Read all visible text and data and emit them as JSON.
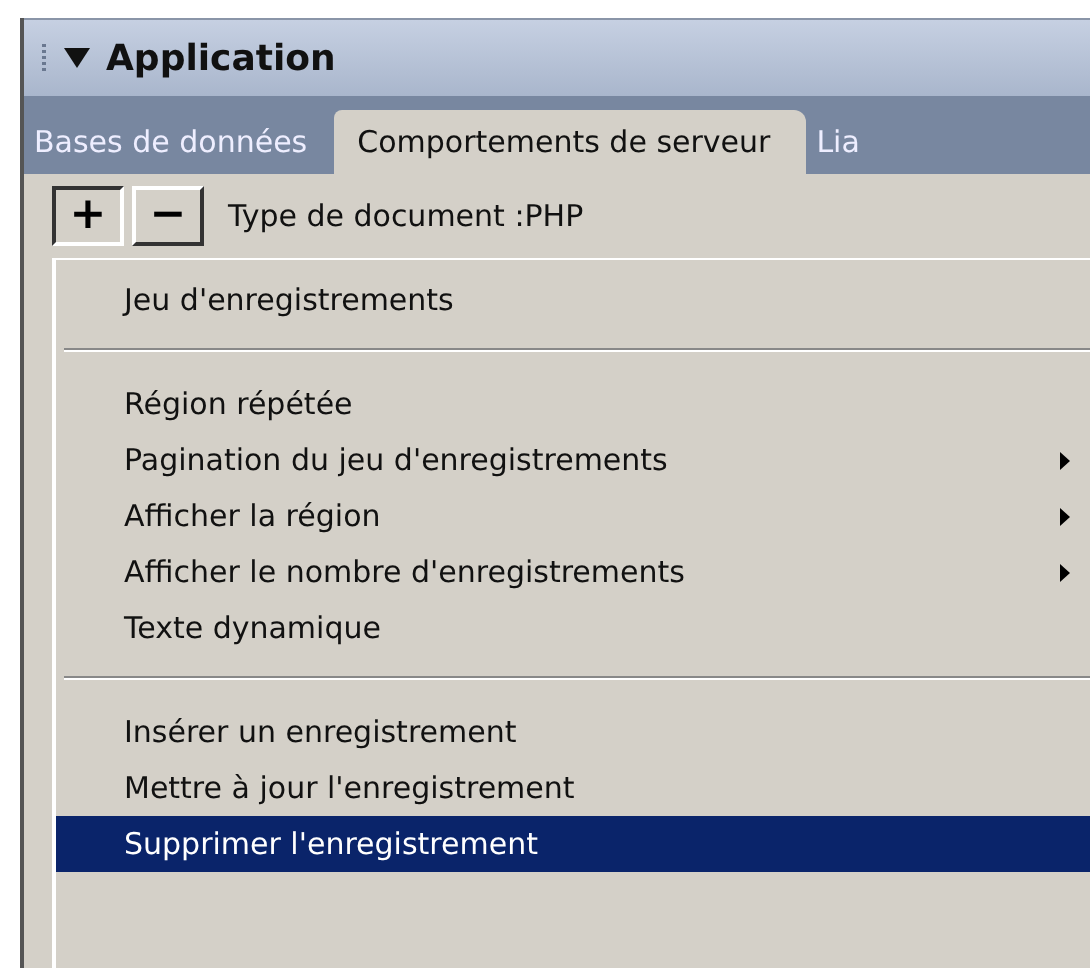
{
  "panel": {
    "title": "Application",
    "expanded": true
  },
  "tabs": [
    {
      "label": "Bases de données",
      "selected": false
    },
    {
      "label": "Comportements de serveur",
      "selected": true
    },
    {
      "label": "Lia",
      "selected": false
    }
  ],
  "toolbar": {
    "add_label": "+",
    "remove_label": "−",
    "document_type": "Type de document :PHP"
  },
  "menu": [
    {
      "kind": "item",
      "label": "Jeu d'enregistrements",
      "submenu": false,
      "selected": false
    },
    {
      "kind": "separator"
    },
    {
      "kind": "item",
      "label": "Région répétée",
      "submenu": false,
      "selected": false
    },
    {
      "kind": "item",
      "label": "Pagination du jeu d'enregistrements",
      "submenu": true,
      "selected": false
    },
    {
      "kind": "item",
      "label": "Afficher la région",
      "submenu": true,
      "selected": false
    },
    {
      "kind": "item",
      "label": "Afficher le nombre d'enregistrements",
      "submenu": true,
      "selected": false
    },
    {
      "kind": "item",
      "label": "Texte dynamique",
      "submenu": false,
      "selected": false
    },
    {
      "kind": "separator"
    },
    {
      "kind": "item",
      "label": "Insérer un enregistrement",
      "submenu": false,
      "selected": false
    },
    {
      "kind": "item",
      "label": "Mettre à jour l'enregistrement",
      "submenu": false,
      "selected": false
    },
    {
      "kind": "item",
      "label": "Supprimer l'enregistrement",
      "submenu": false,
      "selected": true
    }
  ]
}
